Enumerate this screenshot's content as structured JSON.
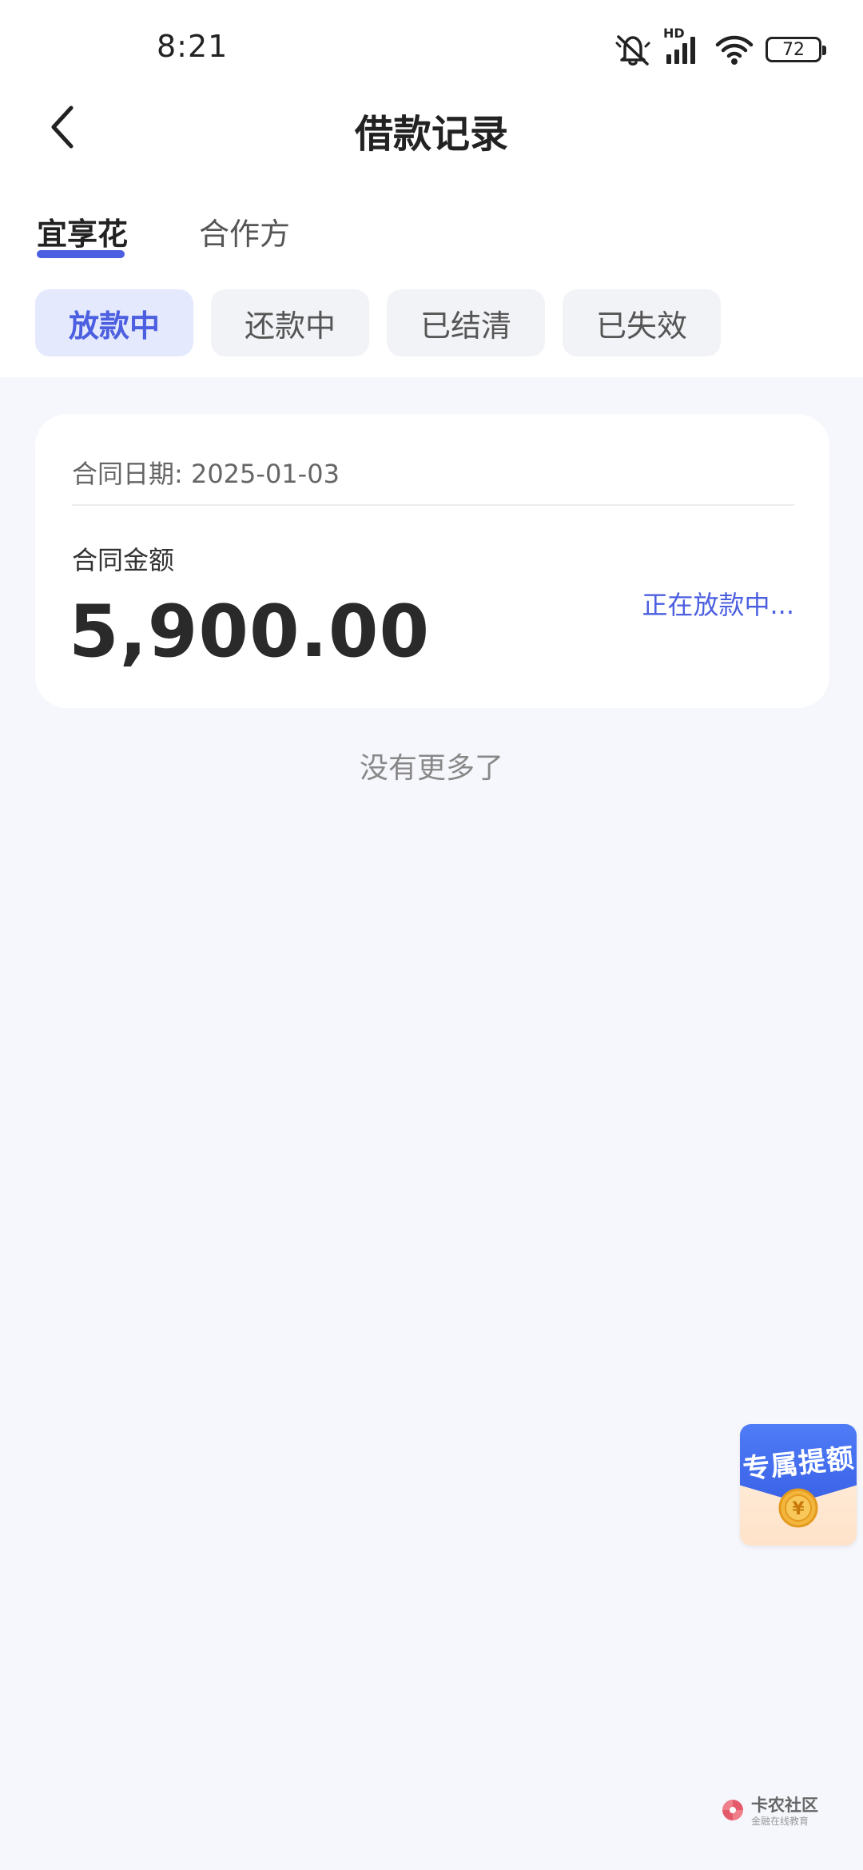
{
  "status_bar": {
    "time": "8:21",
    "network": "HD",
    "battery": "72"
  },
  "header": {
    "title": "借款记录"
  },
  "top_tabs": [
    {
      "label": "宜享花",
      "active": true
    },
    {
      "label": "合作方",
      "active": false
    }
  ],
  "filter_chips": [
    {
      "label": "放款中",
      "active": true
    },
    {
      "label": "还款中",
      "active": false
    },
    {
      "label": "已结清",
      "active": false
    },
    {
      "label": "已失效",
      "active": false
    }
  ],
  "card": {
    "date_label": "合同日期: 2025-01-03",
    "amount_label": "合同金额",
    "amount": "5,900.00",
    "status": "正在放款中..."
  },
  "list_end": "没有更多了",
  "promo": {
    "label": "专属提额",
    "coin_symbol": "¥"
  },
  "watermark": {
    "name": "卡农社区",
    "tagline": "金融在线教育"
  },
  "colors": {
    "accent": "#4c5fe0",
    "page_background": "#f6f7fc",
    "promo_blue": "#3a62e6"
  },
  "icons": {
    "back": "chevron-left-icon",
    "mute": "bell-off-icon",
    "signal": "signal-icon",
    "wifi": "wifi-icon",
    "battery": "battery-icon"
  }
}
